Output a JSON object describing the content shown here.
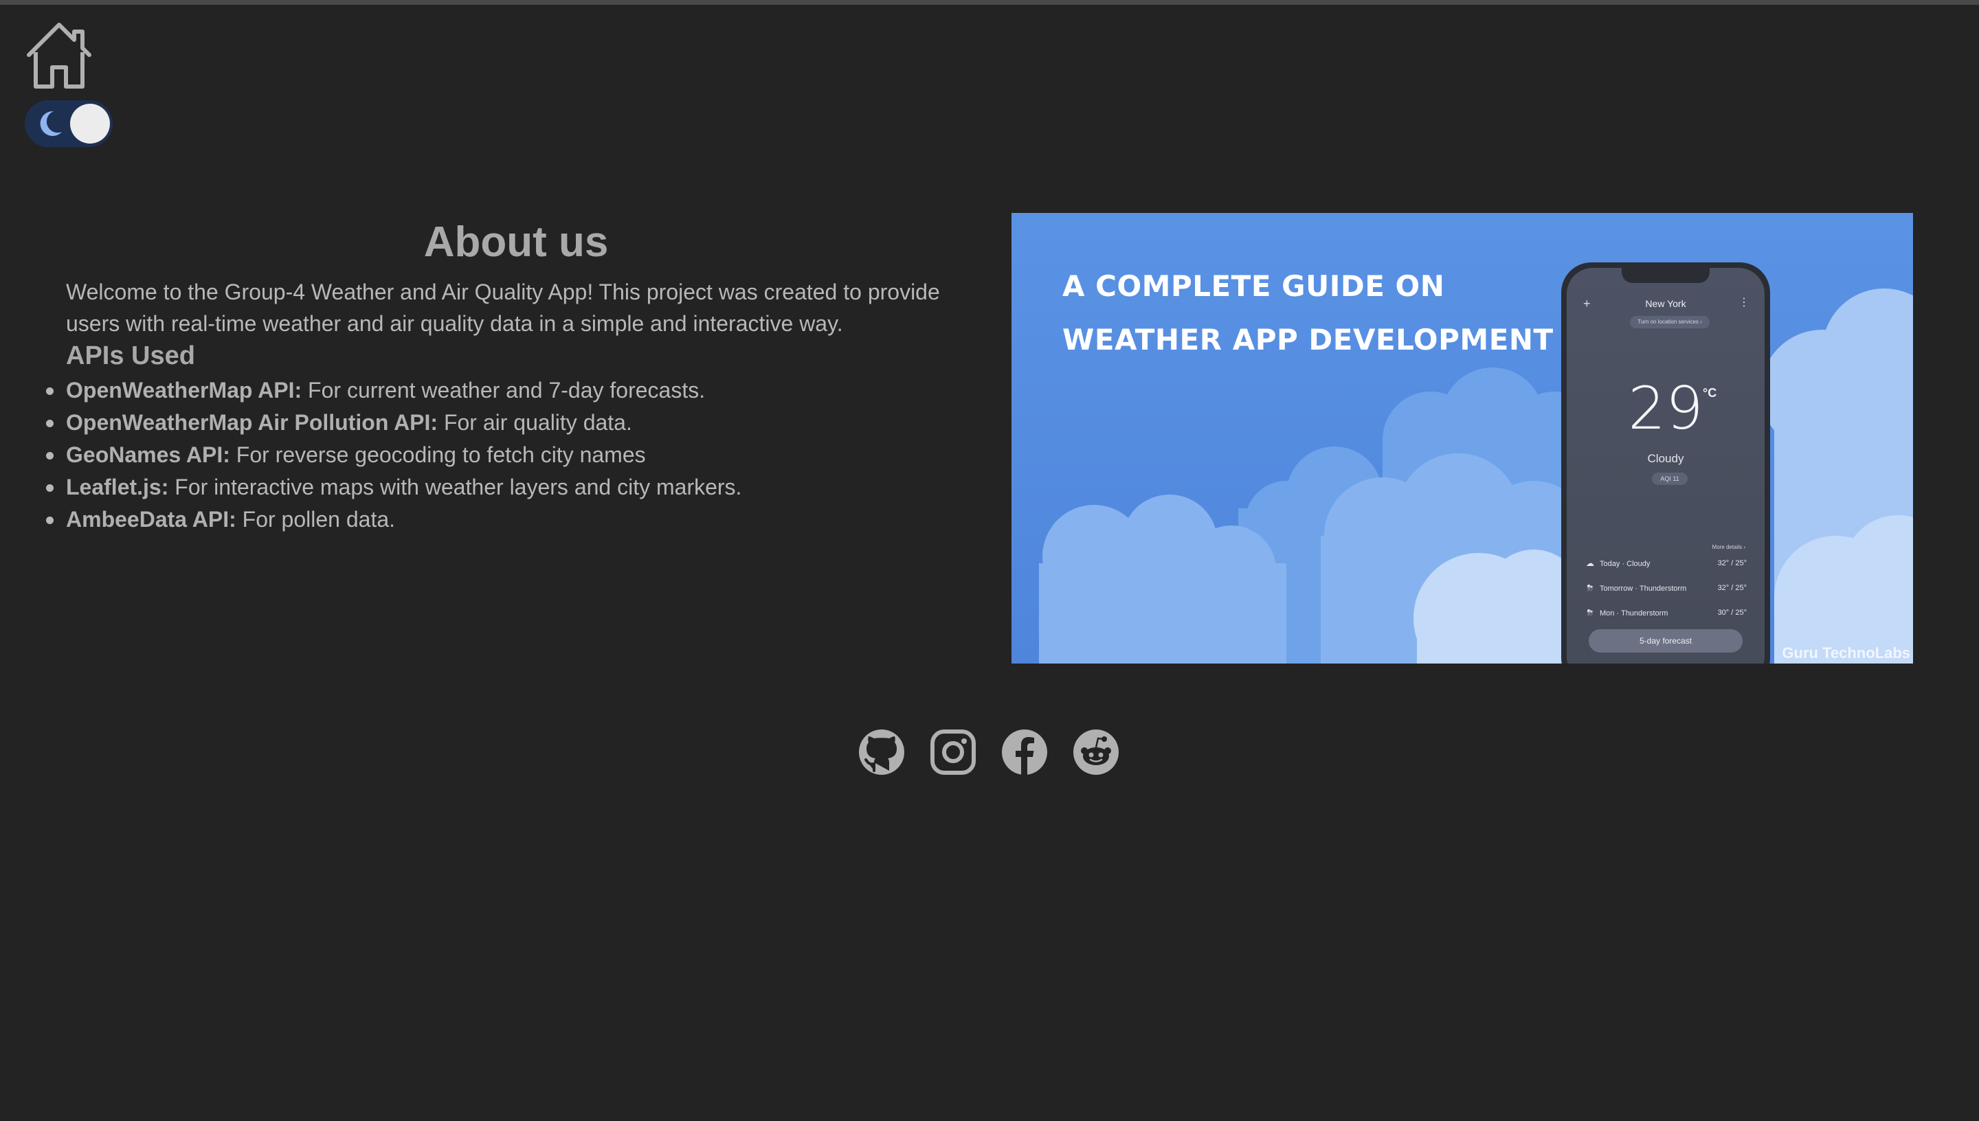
{
  "nav": {
    "home_icon": "home-icon",
    "theme_toggle": {
      "icon": "moon-icon",
      "state": "dark",
      "track_color": "#1e3052",
      "moon_color": "#8fb4f0"
    }
  },
  "about": {
    "title": "About us",
    "intro": "Welcome to the Group-4 Weather and Air Quality App! This project was created to provide users with real-time weather and air quality data in a simple and interactive way.",
    "apis_heading": "APIs Used",
    "apis": [
      {
        "name": "OpenWeatherMap API:",
        "desc": " For current weather and 7-day forecasts."
      },
      {
        "name": "OpenWeatherMap Air Pollution API:",
        "desc": " For air quality data."
      },
      {
        "name": "GeoNames API:",
        "desc": " For reverse geocoding to fetch city names"
      },
      {
        "name": "Leaflet.js:",
        "desc": " For interactive maps with weather layers and city markers."
      },
      {
        "name": "AmbeeData API:",
        "desc": " For pollen data."
      }
    ]
  },
  "banner": {
    "title_line1": "A COMPLETE GUIDE ON",
    "title_line2": "WEATHER APP DEVELOPMENT",
    "brand": "Guru TechnoLabs",
    "bg_color": "#5b92e3",
    "phone": {
      "plus": "+",
      "menu": "⋮",
      "city": "New York",
      "location_chip": "Turn on location services ›",
      "temperature": "29",
      "unit": "°C",
      "condition": "Cloudy",
      "aqi": "AQI 11",
      "more_details": "More details ›",
      "forecast": [
        {
          "icon": "☁",
          "label": "Today · Cloudy",
          "temps": "32° / 25°"
        },
        {
          "icon": "⛈",
          "label": "Tomorrow · Thunderstorm",
          "temps": "32° / 25°"
        },
        {
          "icon": "⛈",
          "label": "Mon · Thunderstorm",
          "temps": "30° / 25°"
        }
      ],
      "forecast_button": "5-day forecast"
    }
  },
  "social": [
    {
      "name": "github-icon"
    },
    {
      "name": "instagram-icon"
    },
    {
      "name": "facebook-icon"
    },
    {
      "name": "reddit-icon"
    }
  ],
  "colors": {
    "page_bg": "#232323",
    "text": "#b8b8b8",
    "heading": "#a9a9a9",
    "icon": "#b0b0b0"
  }
}
